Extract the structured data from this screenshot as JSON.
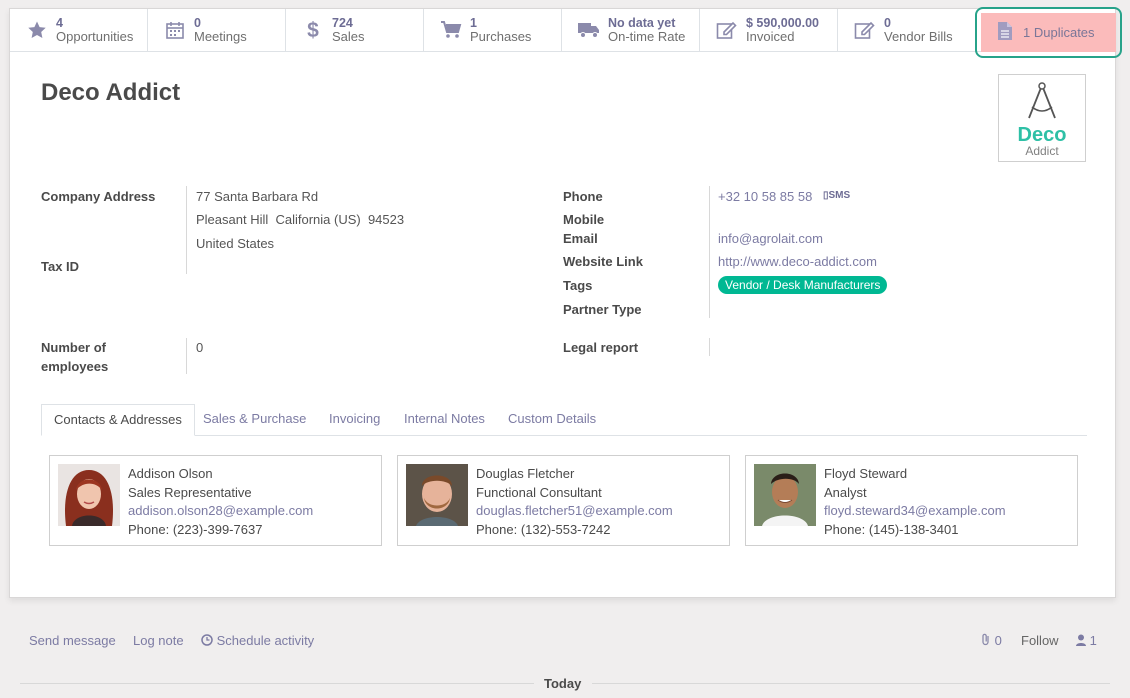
{
  "smart_buttons": [
    {
      "value": "4",
      "label": "Opportunities",
      "icon": "star-icon"
    },
    {
      "value": "0",
      "label": "Meetings",
      "icon": "calendar-icon"
    },
    {
      "value": "724",
      "label": "Sales",
      "icon": "dollar-icon"
    },
    {
      "value": "1",
      "label": "Purchases",
      "icon": "cart-icon"
    },
    {
      "value": "No data yet",
      "label": "On-time Rate",
      "icon": "truck-icon"
    },
    {
      "value": "$ 590,000.00",
      "label": "Invoiced",
      "icon": "edit-icon"
    },
    {
      "value": "0",
      "label": "Vendor Bills",
      "icon": "edit-icon"
    }
  ],
  "duplicates": {
    "label": "1 Duplicates",
    "icon": "document-icon"
  },
  "record": {
    "name": "Deco Addict",
    "logo": {
      "line1": "Deco",
      "line2": "Addict"
    }
  },
  "left_fields": {
    "company_address_label": "Company Address",
    "street": "77 Santa Barbara Rd",
    "city_line": "Pleasant Hill  California (US)  94523",
    "country": "United States",
    "tax_id_label": "Tax ID",
    "employees_label_1": "Number of",
    "employees_label_2": "employees",
    "employees_value": "0"
  },
  "right_fields": {
    "phone_label": "Phone",
    "phone_value": "+32 10 58 85 58",
    "sms_label": "SMS",
    "mobile_label": "Mobile",
    "email_label": "Email",
    "email_value": "info@agrolait.com",
    "website_label": "Website Link",
    "website_value": "http://www.deco-addict.com",
    "tags_label": "Tags",
    "tag_value": "Vendor / Desk Manufacturers",
    "partner_type_label": "Partner Type",
    "legal_report_label": "Legal report"
  },
  "tabs": [
    {
      "label": "Contacts & Addresses",
      "active": true
    },
    {
      "label": "Sales & Purchase"
    },
    {
      "label": "Invoicing"
    },
    {
      "label": "Internal Notes"
    },
    {
      "label": "Custom Details"
    }
  ],
  "contacts": [
    {
      "name": "Addison Olson",
      "role": "Sales Representative",
      "email": "addison.olson28@example.com",
      "phone": "Phone: (223)-399-7637"
    },
    {
      "name": "Douglas Fletcher",
      "role": "Functional Consultant",
      "email": "douglas.fletcher51@example.com",
      "phone": "Phone: (132)-553-7242"
    },
    {
      "name": "Floyd Steward",
      "role": "Analyst",
      "email": "floyd.steward34@example.com",
      "phone": "Phone: (145)-138-3401"
    }
  ],
  "chatter": {
    "send_message": "Send message",
    "log_note": "Log note",
    "schedule_activity": "Schedule activity",
    "attachments_count": "0",
    "follow": "Follow",
    "followers_count": "1",
    "today": "Today"
  },
  "colors": {
    "accent": "#7c7ba3",
    "tag_green": "#00b893",
    "duplicate_bg": "#fbbbbb",
    "highlight_border": "#27a38a"
  }
}
